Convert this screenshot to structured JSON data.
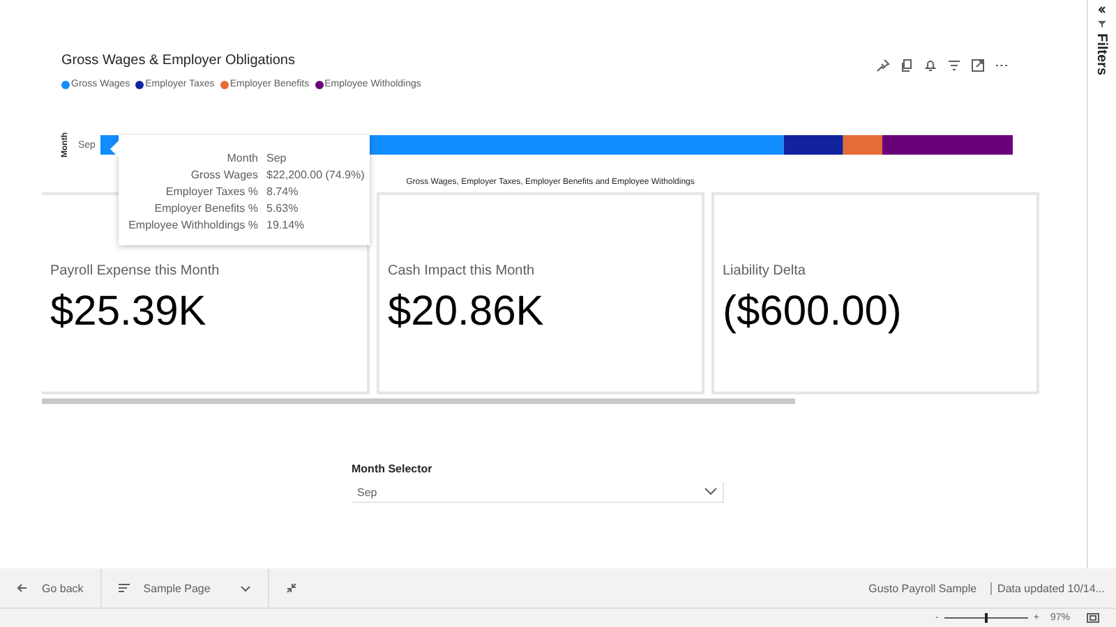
{
  "chart": {
    "title": "Gross Wages & Employer Obligations",
    "legend": [
      {
        "name": "Gross Wages",
        "color": "#118dff"
      },
      {
        "name": "Employer Taxes",
        "color": "#12239e"
      },
      {
        "name": "Employer Benefits",
        "color": "#e66c37"
      },
      {
        "name": "Employee Witholdings",
        "color": "#6b007b"
      }
    ],
    "y_axis_title": "Month",
    "category": "Sep",
    "x_axis_title": "Gross Wages, Employer Taxes, Employer Benefits and Employee Witholdings",
    "tooltip": [
      {
        "label": "Month",
        "value": "Sep"
      },
      {
        "label": "Gross Wages",
        "value": "$22,200.00 (74.9%)"
      },
      {
        "label": "Employer Taxes %",
        "value": "8.74%"
      },
      {
        "label": "Employer Benefits %",
        "value": "5.63%"
      },
      {
        "label": "Employee Withholdings %",
        "value": "19.14%"
      }
    ]
  },
  "cards": [
    {
      "label": "Payroll Expense this Month",
      "value": "$25.39K"
    },
    {
      "label": "Cash Impact this Month",
      "value": "$20.86K"
    },
    {
      "label": "Liability Delta",
      "value": "($600.00)"
    }
  ],
  "month_selector": {
    "label": "Month Selector",
    "value": "Sep"
  },
  "filters_pane": {
    "title": "Filters"
  },
  "footer": {
    "back": "Go back",
    "page": "Sample Page",
    "report": "Gusto Payroll Sample",
    "updated": "Data updated 10/14..."
  },
  "zoom": {
    "minus": "-",
    "plus": "+",
    "percent": "97%",
    "level": 0.5
  }
}
